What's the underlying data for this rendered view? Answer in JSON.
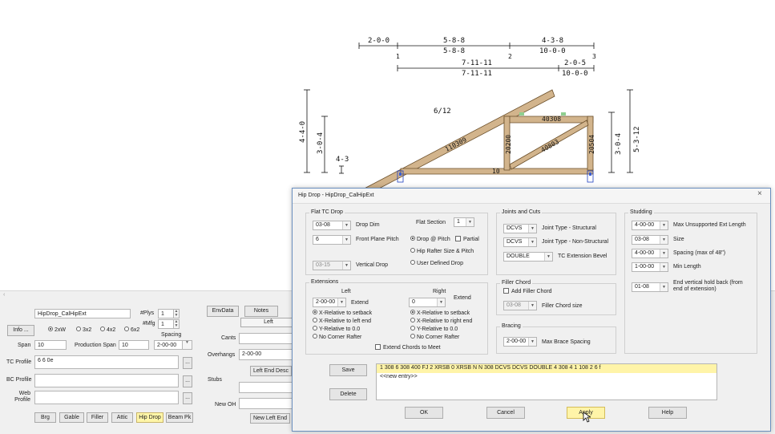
{
  "drawing": {
    "top_dims": {
      "seg1": "2-0-0",
      "seg2_top": "5-8-8",
      "seg2_bot": "5-8-8",
      "seg3_top": "4-3-8",
      "seg3_bot": "10-0-0",
      "node1": "1",
      "node2": "2",
      "node3": "3",
      "row2_top": "7-11-11",
      "row2_bot": "7-11-11",
      "row2_right_top": "2-0-5",
      "row2_right_bot": "10-0-0"
    },
    "pitch": "6/12",
    "left_dims": {
      "outer": "4-4-0",
      "inner": "3-0-4",
      "small": "4-3"
    },
    "right_dims": {
      "inner": "3-0-4",
      "outer": "5-3-12"
    },
    "members": {
      "top_chord": "110309",
      "vert_left": "20200",
      "top_right": "40308",
      "web": "40803",
      "vert_right": "20504",
      "bottom": "10"
    }
  },
  "panel": {
    "name_value": "HipDrop_CalHipExt",
    "plys_label": "#Plys",
    "plys_value": "1",
    "mfg_label": "#Mfg",
    "mfg_value": "1",
    "info_label": "Info ...",
    "sizes": [
      "2xW",
      "3x2",
      "4x2",
      "6x2"
    ],
    "spacing_label": "Spacing",
    "spacing_value": "2-00-00",
    "span_label": "Span",
    "span_value": "10",
    "prod_span_label": "Production Span",
    "prod_span_value": "10",
    "tc_profile_label": "TC Profile",
    "tc_profile_value": "6 6 0e",
    "bc_profile_label": "BC Profile",
    "bc_profile_value": "",
    "web_profile_label": "Web Profile",
    "web_profile_value": "",
    "browse": "...",
    "tabs": [
      "Brg",
      "Gable",
      "Filler",
      "Attic",
      "Hip Drop",
      "Beam Pk"
    ],
    "envdata": "EnvData",
    "notes": "Notes",
    "left_tab": "Left",
    "cants_label": "Cants",
    "overhangs_label": "Overhangs",
    "overhangs_value": "2-00-00",
    "left_end_desc": "Left End Desc",
    "stubs_label": "Stubs",
    "new_oh_label": "New OH",
    "new_left_end": "New Left End"
  },
  "dialog": {
    "title": "Hip Drop - HipDrop_CalHipExt",
    "close": "×",
    "flat_tc": {
      "legend": "Flat TC Drop",
      "drop_dim_value": "03-08",
      "drop_dim_label": "Drop Dim",
      "flat_section_label": "Flat Section",
      "flat_section_value": "1",
      "front_pitch_value": "6",
      "front_pitch_label": "Front Plane Pitch",
      "opt_drop_pitch": "Drop @ Pitch",
      "opt_partial": "Partial",
      "opt_hip_rafter": "Hip Rafter Size  & Pitch",
      "vertical_drop_value": "03-15",
      "vertical_drop_label": "Vertical Drop",
      "opt_user": "User Defined Drop"
    },
    "extensions": {
      "legend": "Extensions",
      "left_label": "Left",
      "right_label": "Right",
      "left_value": "2-00-00",
      "right_value": "0",
      "extend": "Extend",
      "left_opts": [
        "X-Relative to setback",
        "X-Relative to left end",
        "Y-Relative to 0.0",
        "No Corner Rafter"
      ],
      "right_opts": [
        "X-Relative to setback",
        "X-Relative to right end",
        "Y-Relative to 0.0",
        "No Corner Rafter"
      ],
      "extend_meet": "Extend Chords to Meet"
    },
    "joints": {
      "legend": "Joints and Cuts",
      "j1_value": "DCVS",
      "j1_label": "Joint Type - Structural",
      "j2_value": "DCVS",
      "j2_label": "Joint Type - Non-Structural",
      "bevel_value": "DOUBLE",
      "bevel_label": "TC Extension Bevel"
    },
    "filler": {
      "legend": "Filler Chord",
      "add_label": "Add Filler Chord",
      "size_value": "03-08",
      "size_label": "Filler Chord size"
    },
    "bracing": {
      "legend": "Bracing",
      "value": "2-00-00",
      "label": "Max Brace Spacing"
    },
    "studding": {
      "legend": "Studding",
      "max_ext_value": "4-00-00",
      "max_ext_label": "Max Unsupported Ext Length",
      "size_value": "03-08",
      "size_label": "Size",
      "spacing_value": "4-00-00",
      "spacing_label": "Spacing (max of 48\")",
      "min_len_value": "1-00-00",
      "min_len_label": "Min Length",
      "holdback_value": "01-08",
      "holdback_label": "End vertical hold back (from end of extension)"
    },
    "list": {
      "entry1": "1 308 6 308 400 FJ 2 XRSB 0 XRSB N N 308 DCVS DCVS DOUBLE 4 308 4 1 108 2 6 f",
      "entry2": "<<new entry>>"
    },
    "save": "Save",
    "delete": "Delete",
    "ok": "OK",
    "cancel": "Cancel",
    "apply": "Apply",
    "help": "Help"
  }
}
